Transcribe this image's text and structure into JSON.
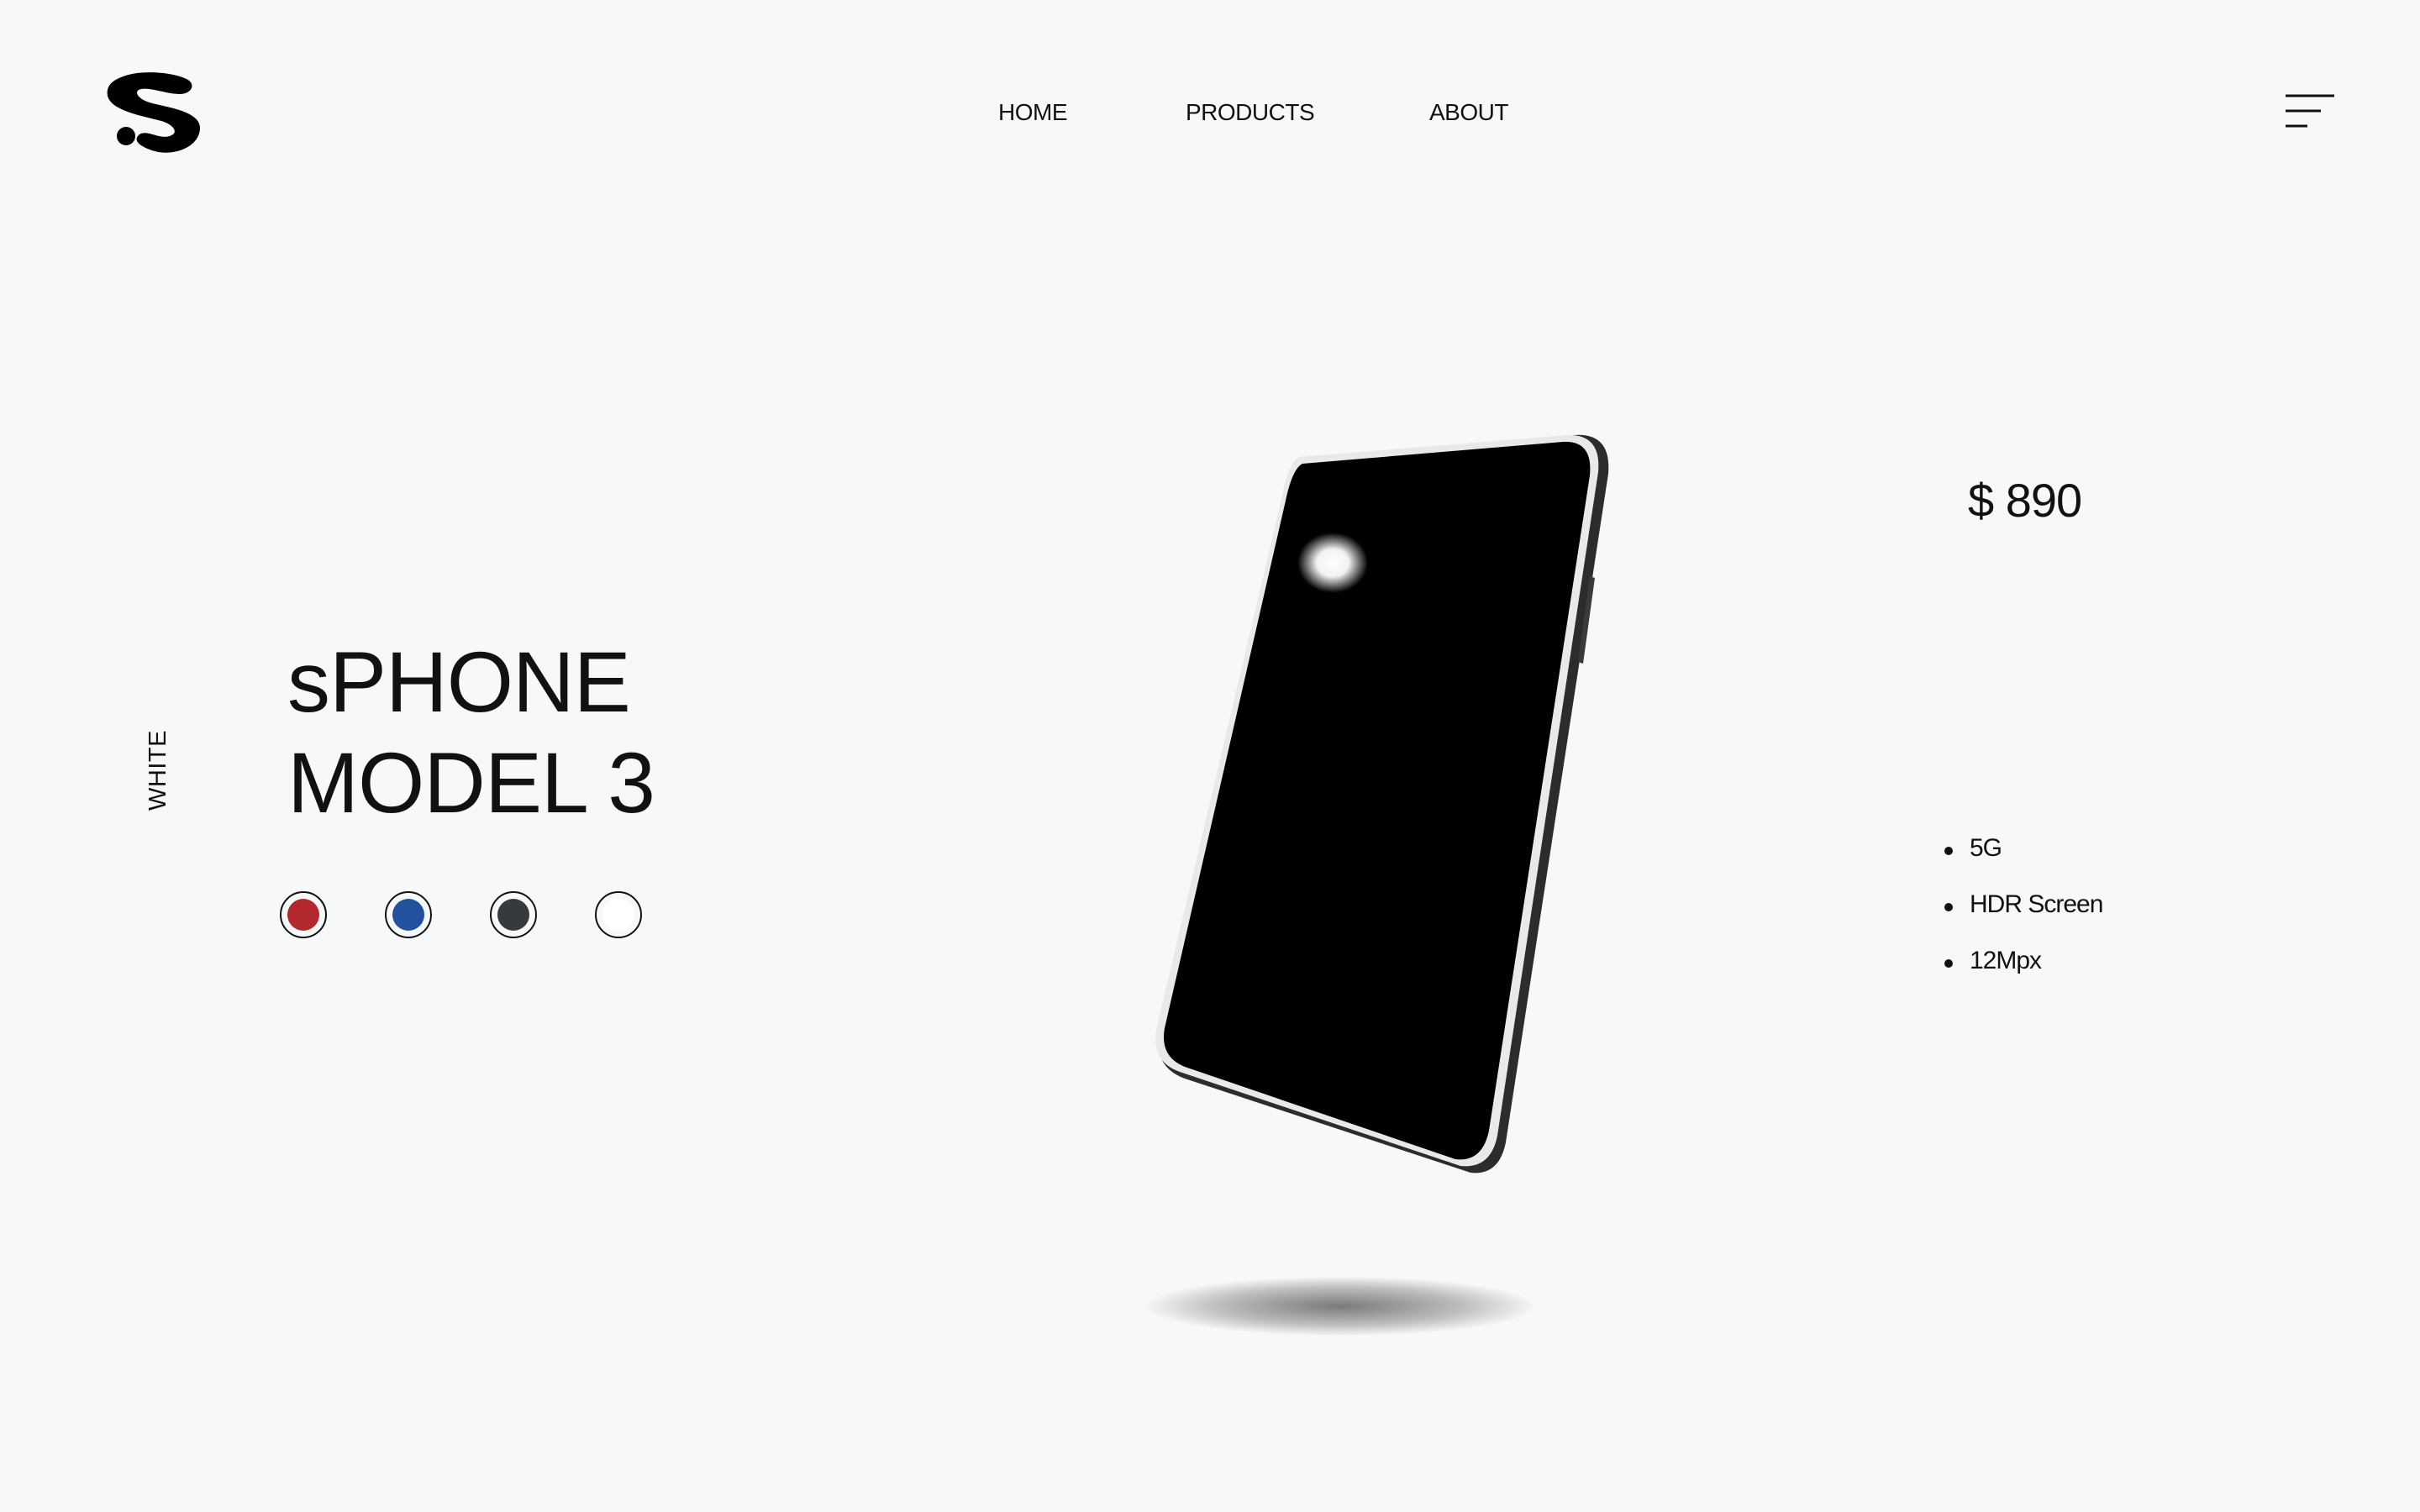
{
  "header": {
    "logo_name": "s-logo",
    "nav": [
      {
        "label": "HOME"
      },
      {
        "label": "PRODUCTS"
      },
      {
        "label": "ABOUT"
      }
    ],
    "menu_icon": "hamburger-menu-icon"
  },
  "product": {
    "selected_color_label": "WHITE",
    "title_line1": "sPHONE",
    "title_line2": "MODEL 3",
    "price": "$ 890",
    "color_options": [
      {
        "name": "red",
        "color": "#b3282d"
      },
      {
        "name": "blue",
        "color": "#22519e"
      },
      {
        "name": "dark-gray",
        "color": "#353a3d"
      },
      {
        "name": "white",
        "color": "#ffffff"
      }
    ],
    "features": [
      "5G",
      "HDR Screen",
      "12Mpx"
    ]
  },
  "colors": {
    "background": "#f7f8fa",
    "text": "#111111",
    "phone_body": "#000000"
  }
}
